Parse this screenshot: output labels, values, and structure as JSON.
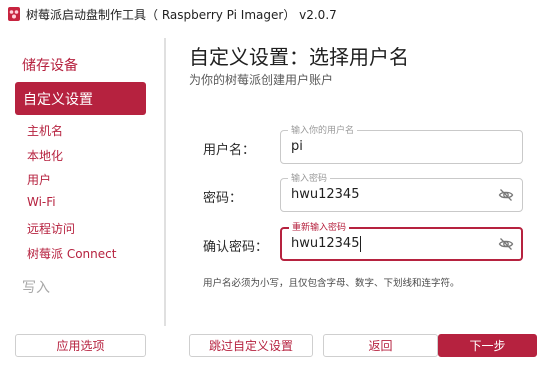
{
  "window": {
    "title": "树莓派启动盘制作工具（ Raspberry Pi Imager） v2.0.7"
  },
  "sidebar": {
    "section_storage": "储存设备",
    "section_custom": "自定义设置",
    "items": [
      {
        "label": "主机名"
      },
      {
        "label": "本地化"
      },
      {
        "label": "用户"
      },
      {
        "label": "Wi-Fi"
      },
      {
        "label": "远程访问"
      },
      {
        "label": "树莓派 Connect"
      }
    ],
    "section_write": "写入"
  },
  "main": {
    "title": "自定义设置：选择用户名",
    "subtitle": "为你的树莓派创建用户账户",
    "username": {
      "label": "用户名：",
      "legend": "输入你的用户名",
      "value": "pi"
    },
    "password": {
      "label": "密码：",
      "legend": "输入密码",
      "value": "hwu12345"
    },
    "confirm": {
      "label": "确认密码：",
      "legend": "重新输入密码",
      "value": "hwu12345"
    },
    "hint": "用户名必须为小写，且仅包含字母、数字、下划线和连字符。"
  },
  "buttons": {
    "apply_options": "应用选项",
    "skip_custom": "跳过自定义设置",
    "back": "返回",
    "next": "下一步"
  },
  "colors": {
    "accent": "#b6223f",
    "disabled": "#a8a8a8"
  },
  "icons": {
    "app": "raspberry-icon",
    "show_password": "eye-slash-icon"
  }
}
